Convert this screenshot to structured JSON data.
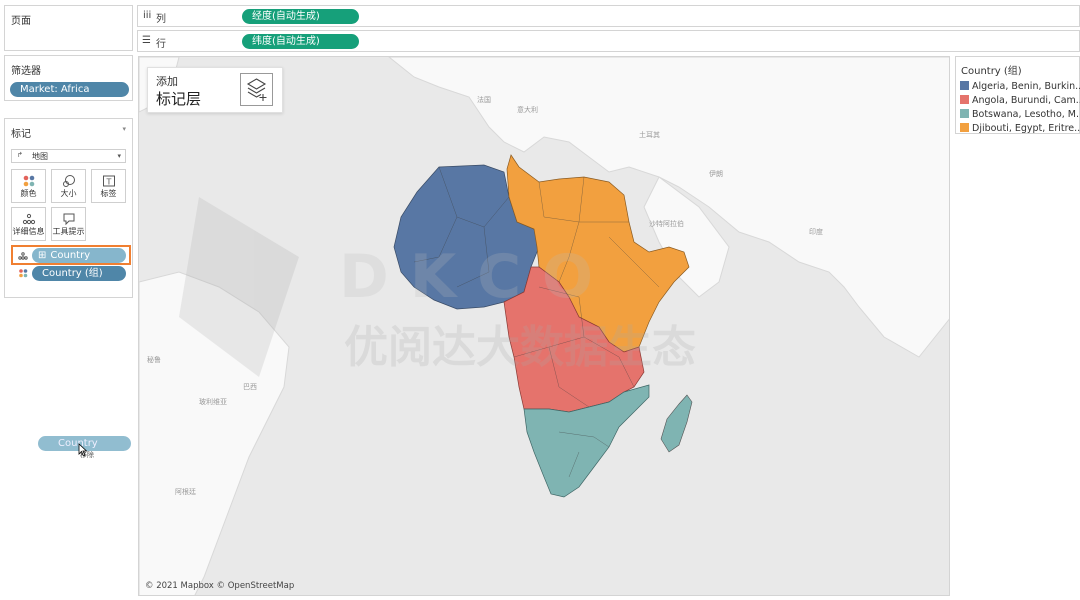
{
  "pages_panel": {
    "title": "页面"
  },
  "shelves": {
    "columns": {
      "icon": "iii",
      "label": "列",
      "pill": "经度(自动生成)"
    },
    "rows": {
      "icon": "☰",
      "label": "行",
      "pill": "纬度(自动生成)"
    }
  },
  "filters_panel": {
    "title": "筛选器",
    "pill": "Market: Africa"
  },
  "marks_panel": {
    "title": "标记",
    "mark_type": "地图",
    "buttons": [
      {
        "label": "颜色",
        "icon": "color-dots-icon"
      },
      {
        "label": "大小",
        "icon": "size-icon"
      },
      {
        "label": "标签",
        "icon": "label-T-icon"
      },
      {
        "label": "详细信息",
        "icon": "detail-dots-icon"
      },
      {
        "label": "工具提示",
        "icon": "tooltip-bubble-icon"
      }
    ],
    "fields": [
      {
        "label": "Country",
        "prefix": "⊞"
      },
      {
        "label": "Country (组)"
      }
    ]
  },
  "drag_pill": {
    "label": "Country",
    "hint": "移除"
  },
  "map": {
    "add_layer_line1": "添加",
    "add_layer_line2": "标记层",
    "attribution": "© 2021 Mapbox © OpenStreetMap",
    "watermark_text": "优阅达大数据生态",
    "watermark_letters": "D  K  C  O",
    "place_labels": [
      "法国",
      "意大利",
      "土耳其",
      "伊朗",
      "沙特阿拉伯",
      "印度",
      "巴西",
      "阿根廷",
      "秘鲁",
      "玻利维亚"
    ]
  },
  "legend": {
    "title": "Country (组)",
    "items": [
      {
        "label": "Algeria, Benin, Burkin..",
        "color": "#5877a4"
      },
      {
        "label": "Angola, Burundi, Cam..",
        "color": "#e5736c"
      },
      {
        "label": "Botswana, Lesotho, M..",
        "color": "#7fb4b2"
      },
      {
        "label": "Djibouti, Egypt, Eritre..",
        "color": "#f2a03f"
      }
    ]
  },
  "colors": {
    "green_pill": "#16a07a",
    "blue_pill": "#4f86a8",
    "highlight_orange": "#f07f31"
  }
}
